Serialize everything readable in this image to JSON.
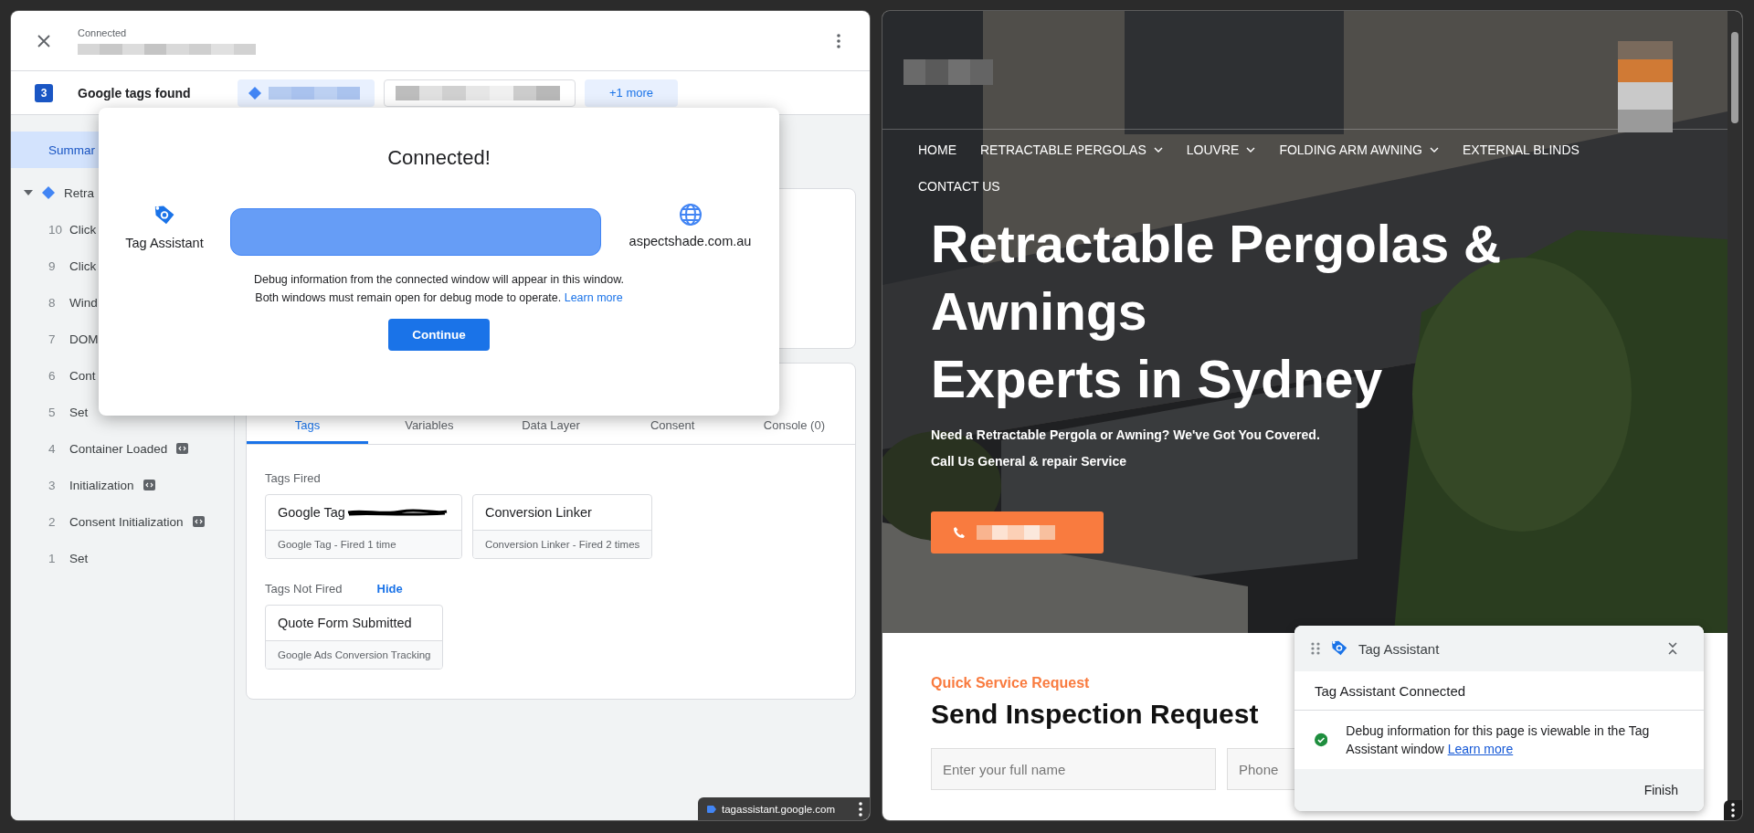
{
  "tag_assistant": {
    "header": {
      "status": "Connected"
    },
    "tags_found": {
      "count": "3",
      "label": "Google tags found",
      "more_chip": "+1 more"
    },
    "sidebar": [
      {
        "kind": "summary",
        "label": "Summar",
        "selected": true
      },
      {
        "kind": "group",
        "label": "Retra",
        "expanded": true,
        "selected": false
      },
      {
        "kind": "event",
        "number": "10",
        "label": "Click",
        "code_badge": false,
        "selected": false
      },
      {
        "kind": "event",
        "number": "9",
        "label": "Click",
        "code_badge": false,
        "selected": false
      },
      {
        "kind": "event",
        "number": "8",
        "label": "Wind",
        "code_badge": false,
        "selected": false
      },
      {
        "kind": "event",
        "number": "7",
        "label": "DOM",
        "code_badge": false,
        "selected": false
      },
      {
        "kind": "event",
        "number": "6",
        "label": "Cont",
        "code_badge": false,
        "selected": false
      },
      {
        "kind": "event",
        "number": "5",
        "label": "Set",
        "code_badge": false,
        "selected": false
      },
      {
        "kind": "event",
        "number": "4",
        "label": "Container Loaded",
        "code_badge": true,
        "selected": false
      },
      {
        "kind": "event",
        "number": "3",
        "label": "Initialization",
        "code_badge": true,
        "selected": false
      },
      {
        "kind": "event",
        "number": "2",
        "label": "Consent Initialization",
        "code_badge": true,
        "selected": false
      },
      {
        "kind": "event",
        "number": "1",
        "label": "Set",
        "code_badge": false,
        "selected": false
      }
    ],
    "tabs": [
      {
        "label": "Tags",
        "selected": true
      },
      {
        "label": "Variables",
        "selected": false
      },
      {
        "label": "Data Layer",
        "selected": false
      },
      {
        "label": "Consent",
        "selected": false
      },
      {
        "label": "Console (0)",
        "selected": false
      }
    ],
    "tags_fired": {
      "title": "Tags Fired",
      "tags": [
        {
          "name": "Google Tag",
          "detail": "Google Tag - Fired 1 time",
          "redacted": true
        },
        {
          "name": "Conversion Linker",
          "detail": "Conversion Linker - Fired 2 times",
          "redacted": false
        }
      ]
    },
    "tags_not_fired": {
      "title": "Tags Not Fired",
      "toggle": "Hide",
      "tags": [
        {
          "name": "Quote Form Submitted",
          "detail": "Google Ads Conversion Tracking",
          "redacted": false
        }
      ]
    },
    "dialog": {
      "title": "Connected!",
      "source": "Tag Assistant",
      "target": "aspectshade.com.au",
      "message_line_1": "Debug information from the connected window will appear in this window.",
      "message_line_2": "Both windows must remain open for debug mode to operate.",
      "link": "Learn more",
      "button": "Continue"
    },
    "url_chip": "tagassistant.google.com"
  },
  "website": {
    "nav": [
      {
        "label": "HOME",
        "dropdown": false
      },
      {
        "label": "RETRACTABLE PERGOLAS",
        "dropdown": true
      },
      {
        "label": "LOUVRE",
        "dropdown": true
      },
      {
        "label": "FOLDING ARM AWNING",
        "dropdown": true
      },
      {
        "label": "EXTERNAL BLINDS",
        "dropdown": false
      },
      {
        "label": "CONTACT US",
        "dropdown": false
      }
    ],
    "hero": {
      "heading_lines": [
        "Retractable Pergolas &",
        "Awnings",
        "Experts in Sydney"
      ],
      "subtitle_lines": [
        "Need a Retractable Pergola or Awning? We've Got You Covered.",
        "Call Us General & repair Service"
      ]
    },
    "form": {
      "eyebrow": "Quick Service Request",
      "title": "Send Inspection Request",
      "fields": [
        {
          "placeholder": "Enter your full name"
        },
        {
          "placeholder": "Phone"
        }
      ]
    },
    "popup": {
      "title": "Tag Assistant",
      "status": "Tag Assistant Connected",
      "message": "Debug information for this page is viewable in the Tag Assistant window",
      "link": "Learn more",
      "button": "Finish"
    }
  }
}
